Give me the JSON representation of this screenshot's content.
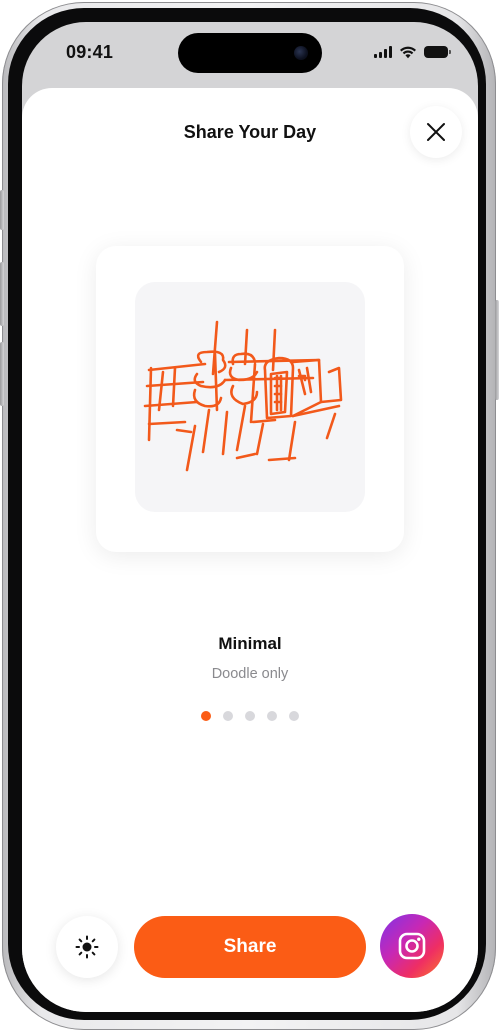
{
  "status_bar": {
    "time": "09:41"
  },
  "sheet": {
    "title": "Share Your Day"
  },
  "style_option": {
    "name": "Minimal",
    "description": "Doodle only"
  },
  "pager": {
    "total": 5,
    "active_index": 0
  },
  "actions": {
    "share_label": "Share",
    "theme_icon": "sun-icon",
    "instagram_icon": "instagram-icon",
    "close_icon": "close-icon"
  },
  "colors": {
    "accent": "#fb5c15",
    "doodle_stroke": "#f2591b",
    "doodle_background": "#f5f5f7",
    "inactive_dot": "#d8d8dc",
    "secondary_text": "#8a8a8e"
  }
}
